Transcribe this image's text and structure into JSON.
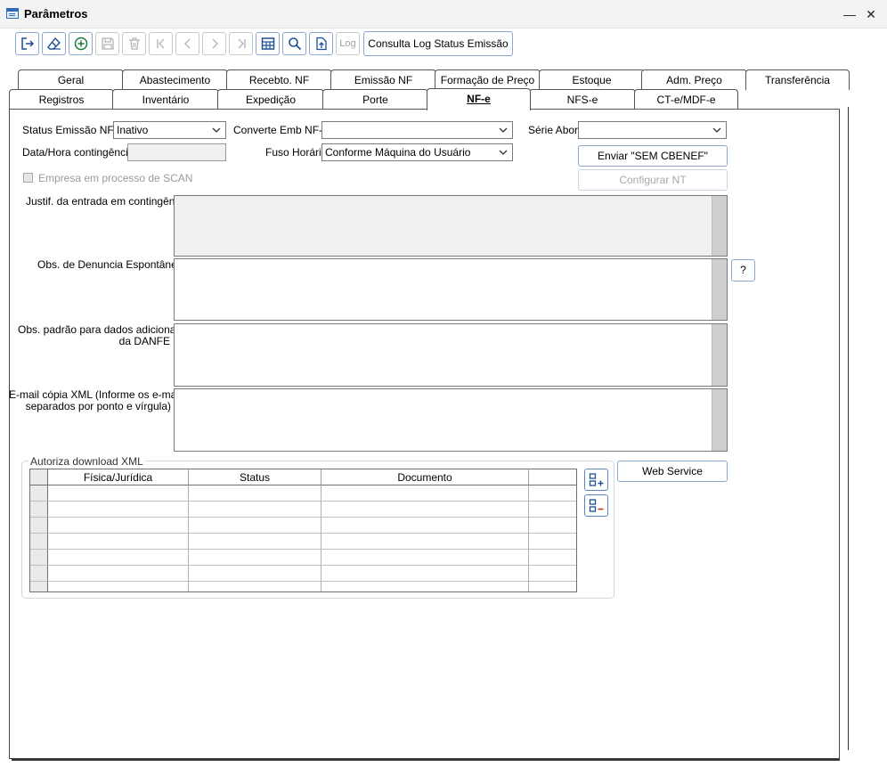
{
  "window": {
    "title": "Parâmetros",
    "minimize": "—",
    "close": "✕"
  },
  "toolbar": {
    "log_label": "Log",
    "consulta_label": "Consulta Log Status Emissão"
  },
  "tabs_row1": [
    "Geral",
    "Abastecimento",
    "Recebto. NF",
    "Emissão NF",
    "Formação de Preço",
    "Estoque",
    "Adm. Preço",
    "Transferência"
  ],
  "tabs_row2": [
    "Registros",
    "Inventário",
    "Expedição",
    "Porte",
    "NF-e",
    "NFS-e",
    "CT-e/MDF-e"
  ],
  "active_tab": "NF-e",
  "form": {
    "status_label": "Status Emissão NF-e",
    "status_value": "Inativo",
    "converte_label": "Converte Emb NF-e",
    "converte_value": "",
    "serie_label": "Série Abort",
    "serie_value": "",
    "datahora_label": "Data/Hora contingência",
    "fuso_label": "Fuso Horário",
    "fuso_value": "Conforme Máquina do Usuário",
    "enviar_label": "Enviar \"SEM CBENEF\"",
    "configurar_label": "Configurar NT",
    "scan_label": "Empresa em processo de SCAN",
    "justif_label": "Justif. da entrada em contingência",
    "obs_denuncia_label": "Obs. de Denuncia Espontânea",
    "help_label": "?",
    "obs_padrao_label_1": "Obs. padrão para dados adicionais",
    "obs_padrao_label_2": "da DANFE",
    "email_label_1": "E-mail cópia XML (Informe os e-mails",
    "email_label_2": "separados por ponto e vírgula)"
  },
  "autoriza": {
    "legend": "Autoriza download XML",
    "columns": [
      "Física/Jurídica",
      "Status",
      "Documento"
    ],
    "web_service_label": "Web Service"
  }
}
